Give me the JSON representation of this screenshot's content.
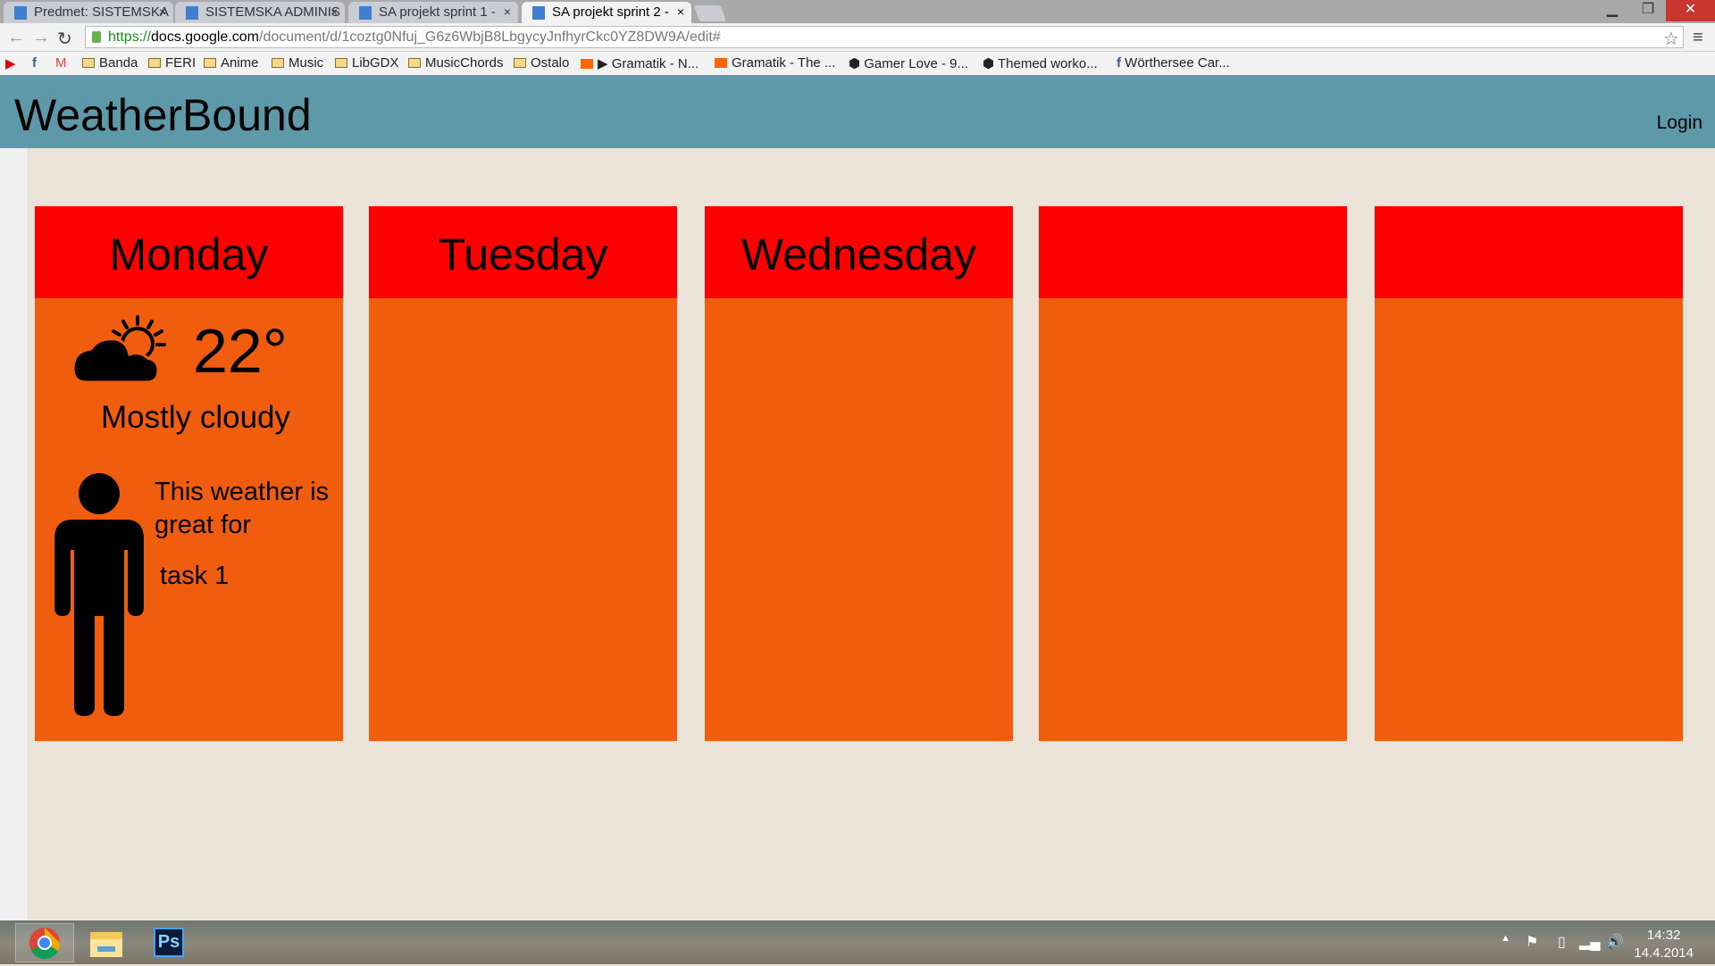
{
  "browser": {
    "tabs": [
      {
        "label": "Predmet: SISTEMSKA",
        "active": false
      },
      {
        "label": "SISTEMSKA ADMINIS",
        "active": false
      },
      {
        "label": "SA projekt sprint 1 -",
        "active": false
      },
      {
        "label": "SA projekt sprint 2 -",
        "active": true
      }
    ],
    "url_scheme": "https://",
    "url_domain": "docs.google.com",
    "url_path": "/document/d/1coztg0Nfuj_G6z6WbjB8LbgycyJnfhyrCkc0YZ8DW9A/edit#",
    "bookmarks": [
      "Banda",
      "FERI",
      "Anime",
      "Music",
      "LibGDX",
      "MusicChords",
      "Ostalo",
      "▶ Gramatik - N...",
      "Gramatik - The ...",
      "Gamer Love - 9...",
      "Themed worko...",
      "Wörthersee Car..."
    ]
  },
  "app": {
    "title": "WeatherBound",
    "login": "Login"
  },
  "days": [
    {
      "name": "Monday",
      "temperature": "22°",
      "condition": "Mostly cloudy",
      "icon": "partly-cloudy-icon",
      "tip": "This weather is great for",
      "task": "task 1"
    },
    {
      "name": "Tuesday"
    },
    {
      "name": "Wednesday"
    },
    {
      "name": ""
    },
    {
      "name": ""
    }
  ],
  "colors": {
    "header": "#5d99a9",
    "day_header": "#fe0000",
    "card": "#f05d0e",
    "background": "#ebe3d7"
  },
  "taskbar": {
    "time": "14:32",
    "date": "14.4.2014",
    "apps": [
      "chrome",
      "file-explorer",
      "photoshop"
    ],
    "ps_label": "Ps"
  }
}
